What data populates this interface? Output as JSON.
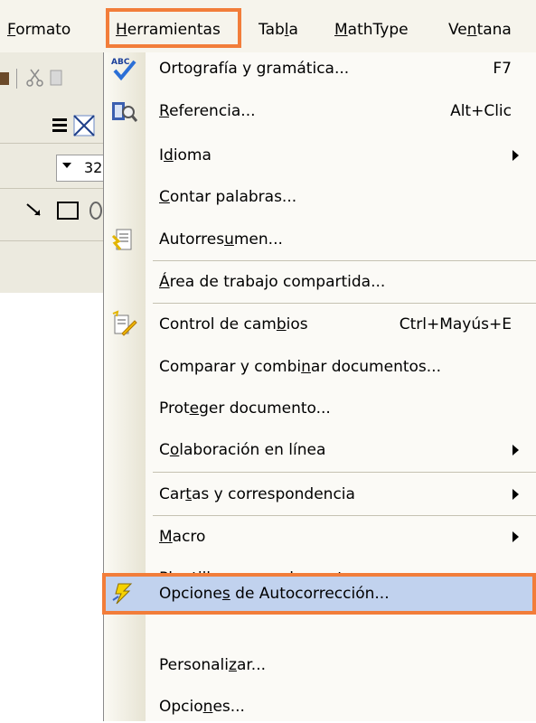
{
  "menubar": {
    "items": [
      {
        "label_pre": "",
        "label_u": "F",
        "label_post": "ormato"
      },
      {
        "label_pre": "",
        "label_u": "H",
        "label_post": "erramientas"
      },
      {
        "label_pre": "Tab",
        "label_u": "l",
        "label_post": "a"
      },
      {
        "label_pre": "",
        "label_u": "M",
        "label_post": "athType"
      },
      {
        "label_pre": "Ve",
        "label_u": "n",
        "label_post": "tana"
      }
    ]
  },
  "toolbar": {
    "font_size_value": "32"
  },
  "menu": {
    "items": [
      {
        "pre": "Ortografía y gramática...",
        "u": "",
        "post": "",
        "shortcut": "F7"
      },
      {
        "pre": "",
        "u": "R",
        "post": "eferencia...",
        "shortcut": "Alt+Clic"
      },
      {
        "pre": "I",
        "u": "d",
        "post": "ioma",
        "shortcut": ""
      },
      {
        "pre": "",
        "u": "C",
        "post": "ontar palabras...",
        "shortcut": ""
      },
      {
        "pre": "Autorres",
        "u": "u",
        "post": "men...",
        "shortcut": ""
      },
      {
        "pre": "",
        "u": "Á",
        "post": "rea de trabajo compartida...",
        "shortcut": ""
      },
      {
        "pre": "Control de cam",
        "u": "b",
        "post": "ios",
        "shortcut": "Ctrl+Mayús+E"
      },
      {
        "pre": "Comparar y combi",
        "u": "n",
        "post": "ar documentos...",
        "shortcut": ""
      },
      {
        "pre": "Prot",
        "u": "e",
        "post": "ger documento...",
        "shortcut": ""
      },
      {
        "pre": "C",
        "u": "o",
        "post": "laboración en línea",
        "shortcut": ""
      },
      {
        "pre": "Car",
        "u": "t",
        "post": "as y correspondencia",
        "shortcut": ""
      },
      {
        "pre": "",
        "u": "M",
        "post": "acro",
        "shortcut": ""
      },
      {
        "pre": "",
        "u": "P",
        "post": "lantillas y complementos...",
        "shortcut": ""
      },
      {
        "pre": "Opcione",
        "u": "s",
        "post": " de Autocorrección...",
        "shortcut": ""
      },
      {
        "pre": "Personali",
        "u": "z",
        "post": "ar...",
        "shortcut": ""
      },
      {
        "pre": "Opcio",
        "u": "n",
        "post": "es...",
        "shortcut": ""
      }
    ]
  },
  "colors": {
    "highlight_border": "#f27d3a",
    "selected_item_bg": "#c1d2ee",
    "menu_bg": "#fbfaf6",
    "menubar_bg": "#f6f4ec"
  }
}
